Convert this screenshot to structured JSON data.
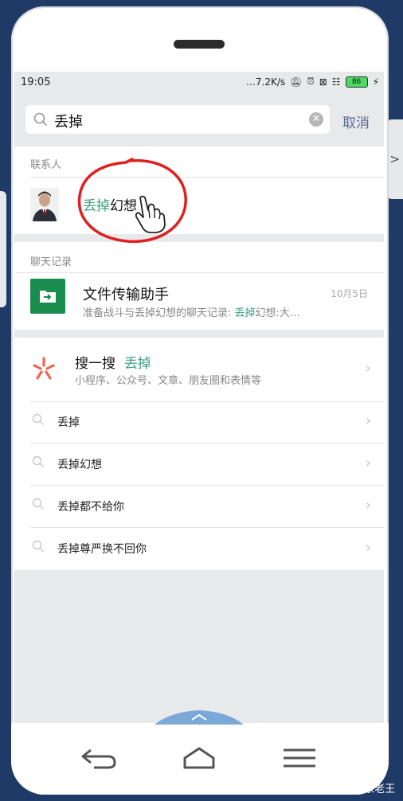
{
  "status_bar": {
    "time": "19:05",
    "speed": "7.2K/s",
    "battery": "86"
  },
  "search": {
    "query": "丢掉",
    "cancel_label": "取消"
  },
  "contacts": {
    "section_label": "联系人",
    "items": [
      {
        "name_highlight": "丢掉",
        "name_rest": "幻想"
      }
    ]
  },
  "chat_records": {
    "section_label": "聊天记录",
    "items": [
      {
        "title": "文件传输助手",
        "date": "10月5日",
        "preview_prefix": "准备战斗与丢掉幻想的聊天记录: ",
        "preview_highlight": "丢掉",
        "preview_suffix": "幻想:大…"
      }
    ]
  },
  "sou_yi_sou": {
    "title": "搜一搜",
    "keyword": "丢掉",
    "subtitle": "小程序、公众号、文章、朋友圈和表情等"
  },
  "suggestions": [
    "丢掉",
    "丢掉幻想",
    "丢掉都不给你",
    "丢掉尊严换不回你"
  ],
  "watermark": "头条 @隔壁家老王",
  "colors": {
    "highlight": "#3aa17e",
    "link": "#576b95",
    "annotation": "#e02020",
    "file_icon": "#1a8d4e",
    "background": "#1f3a66"
  }
}
